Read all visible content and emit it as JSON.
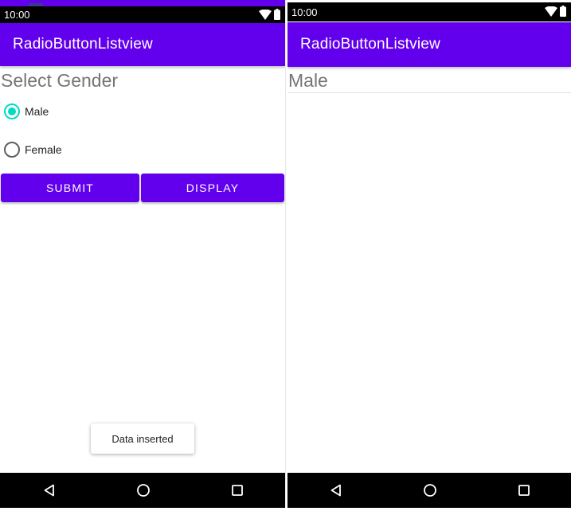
{
  "screens": {
    "left": {
      "status_bar": {
        "time": "10:00"
      },
      "app_bar": {
        "title": "RadioButtonListview"
      },
      "heading": "Select Gender",
      "radio_options": [
        {
          "label": "Male",
          "checked": true
        },
        {
          "label": "Female",
          "checked": false
        }
      ],
      "buttons": {
        "submit": "SUBMIT",
        "display": "DISPLAY"
      },
      "toast": "Data inserted"
    },
    "right": {
      "status_bar": {
        "time": "10:00"
      },
      "app_bar": {
        "title": "RadioButtonListview"
      },
      "list_items": [
        "Male"
      ]
    }
  },
  "colors": {
    "primary": "#6200EE",
    "accent": "#03DAC5",
    "status_bar": "#000000",
    "nav_bar": "#000000",
    "heading_text": "#757575"
  },
  "icons": {
    "status": [
      "wifi-icon",
      "battery-icon"
    ],
    "navigation": [
      "back-icon",
      "home-icon",
      "recents-icon"
    ]
  }
}
